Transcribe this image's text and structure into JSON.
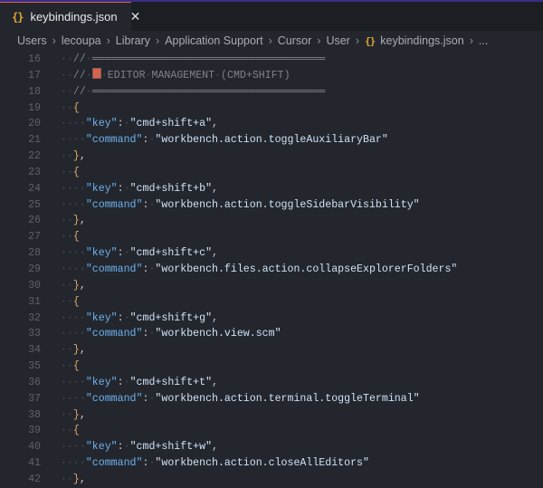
{
  "tab": {
    "icon": "{}",
    "label": "keybindings.json",
    "close": "✕"
  },
  "breadcrumb": [
    "Users",
    "lecoupa",
    "Library",
    "Application Support",
    "Cursor",
    "User"
  ],
  "breadcrumb_file": {
    "icon": "{}",
    "label": "keybindings.json"
  },
  "breadcrumb_more": "...",
  "colors": {
    "accent": "#3a2d86",
    "tab_top": "#d4634f",
    "json_icon": "#e5a633",
    "key": "#6eb0ef"
  },
  "lines": [
    {
      "num": "16",
      "indent": 1,
      "tokens": [
        {
          "t": "// ═════════════════════════════════════",
          "c": "comment"
        }
      ]
    },
    {
      "num": "17",
      "indent": 1,
      "tokens": [
        {
          "t": "// ",
          "c": "comment"
        },
        {
          "t": "📝",
          "c": "emoji"
        },
        {
          "t": " EDITOR MANAGEMENT (CMD+SHIFT)",
          "c": "comment"
        }
      ]
    },
    {
      "num": "18",
      "indent": 1,
      "tokens": [
        {
          "t": "// ═════════════════════════════════════",
          "c": "comment"
        }
      ]
    },
    {
      "num": "19",
      "indent": 1,
      "tokens": [
        {
          "t": "{",
          "c": "brace"
        }
      ]
    },
    {
      "num": "20",
      "indent": 2,
      "tokens": [
        {
          "t": "\"key\"",
          "c": "key"
        },
        {
          "t": ": ",
          "c": "punc"
        },
        {
          "t": "\"cmd+shift+a\"",
          "c": "str"
        },
        {
          "t": ",",
          "c": "punc"
        }
      ]
    },
    {
      "num": "21",
      "indent": 2,
      "tokens": [
        {
          "t": "\"command\"",
          "c": "key"
        },
        {
          "t": ": ",
          "c": "punc"
        },
        {
          "t": "\"workbench.action.toggleAuxiliaryBar\"",
          "c": "str"
        }
      ]
    },
    {
      "num": "22",
      "indent": 1,
      "tokens": [
        {
          "t": "}",
          "c": "brace"
        },
        {
          "t": ",",
          "c": "punc"
        }
      ]
    },
    {
      "num": "23",
      "indent": 1,
      "tokens": [
        {
          "t": "{",
          "c": "brace"
        }
      ]
    },
    {
      "num": "24",
      "indent": 2,
      "tokens": [
        {
          "t": "\"key\"",
          "c": "key"
        },
        {
          "t": ": ",
          "c": "punc"
        },
        {
          "t": "\"cmd+shift+b\"",
          "c": "str"
        },
        {
          "t": ",",
          "c": "punc"
        }
      ]
    },
    {
      "num": "25",
      "indent": 2,
      "tokens": [
        {
          "t": "\"command\"",
          "c": "key"
        },
        {
          "t": ": ",
          "c": "punc"
        },
        {
          "t": "\"workbench.action.toggleSidebarVisibility\"",
          "c": "str"
        }
      ]
    },
    {
      "num": "26",
      "indent": 1,
      "tokens": [
        {
          "t": "}",
          "c": "brace"
        },
        {
          "t": ",",
          "c": "punc"
        }
      ]
    },
    {
      "num": "27",
      "indent": 1,
      "tokens": [
        {
          "t": "{",
          "c": "brace"
        }
      ]
    },
    {
      "num": "28",
      "indent": 2,
      "tokens": [
        {
          "t": "\"key\"",
          "c": "key"
        },
        {
          "t": ": ",
          "c": "punc"
        },
        {
          "t": "\"cmd+shift+c\"",
          "c": "str"
        },
        {
          "t": ",",
          "c": "punc"
        }
      ]
    },
    {
      "num": "29",
      "indent": 2,
      "tokens": [
        {
          "t": "\"command\"",
          "c": "key"
        },
        {
          "t": ": ",
          "c": "punc"
        },
        {
          "t": "\"workbench.files.action.collapseExplorerFolders\"",
          "c": "str"
        }
      ]
    },
    {
      "num": "30",
      "indent": 1,
      "tokens": [
        {
          "t": "}",
          "c": "brace"
        },
        {
          "t": ",",
          "c": "punc"
        }
      ]
    },
    {
      "num": "31",
      "indent": 1,
      "tokens": [
        {
          "t": "{",
          "c": "brace"
        }
      ]
    },
    {
      "num": "32",
      "indent": 2,
      "tokens": [
        {
          "t": "\"key\"",
          "c": "key"
        },
        {
          "t": ": ",
          "c": "punc"
        },
        {
          "t": "\"cmd+shift+g\"",
          "c": "str"
        },
        {
          "t": ",",
          "c": "punc"
        }
      ]
    },
    {
      "num": "33",
      "indent": 2,
      "tokens": [
        {
          "t": "\"command\"",
          "c": "key"
        },
        {
          "t": ": ",
          "c": "punc"
        },
        {
          "t": "\"workbench.view.scm\"",
          "c": "str"
        }
      ]
    },
    {
      "num": "34",
      "indent": 1,
      "tokens": [
        {
          "t": "}",
          "c": "brace"
        },
        {
          "t": ",",
          "c": "punc"
        }
      ]
    },
    {
      "num": "35",
      "indent": 1,
      "tokens": [
        {
          "t": "{",
          "c": "brace"
        }
      ]
    },
    {
      "num": "36",
      "indent": 2,
      "tokens": [
        {
          "t": "\"key\"",
          "c": "key"
        },
        {
          "t": ": ",
          "c": "punc"
        },
        {
          "t": "\"cmd+shift+t\"",
          "c": "str"
        },
        {
          "t": ",",
          "c": "punc"
        }
      ]
    },
    {
      "num": "37",
      "indent": 2,
      "tokens": [
        {
          "t": "\"command\"",
          "c": "key"
        },
        {
          "t": ": ",
          "c": "punc"
        },
        {
          "t": "\"workbench.action.terminal.toggleTerminal\"",
          "c": "str"
        }
      ]
    },
    {
      "num": "38",
      "indent": 1,
      "tokens": [
        {
          "t": "}",
          "c": "brace"
        },
        {
          "t": ",",
          "c": "punc"
        }
      ]
    },
    {
      "num": "39",
      "indent": 1,
      "tokens": [
        {
          "t": "{",
          "c": "brace"
        }
      ]
    },
    {
      "num": "40",
      "indent": 2,
      "tokens": [
        {
          "t": "\"key\"",
          "c": "key"
        },
        {
          "t": ": ",
          "c": "punc"
        },
        {
          "t": "\"cmd+shift+w\"",
          "c": "str"
        },
        {
          "t": ",",
          "c": "punc"
        }
      ]
    },
    {
      "num": "41",
      "indent": 2,
      "tokens": [
        {
          "t": "\"command\"",
          "c": "key"
        },
        {
          "t": ": ",
          "c": "punc"
        },
        {
          "t": "\"workbench.action.closeAllEditors\"",
          "c": "str"
        }
      ]
    },
    {
      "num": "42",
      "indent": 1,
      "tokens": [
        {
          "t": "}",
          "c": "brace"
        },
        {
          "t": ",",
          "c": "punc"
        }
      ]
    }
  ]
}
